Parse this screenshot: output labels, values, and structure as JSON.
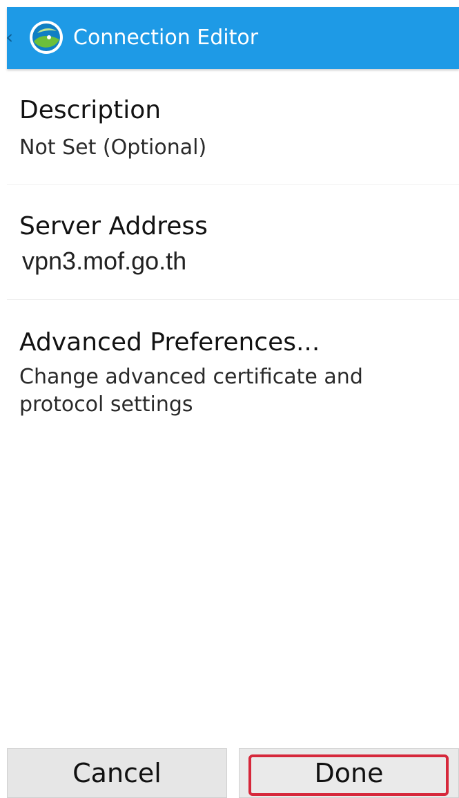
{
  "app": {
    "title": "Connection Editor",
    "icon": "app-logo-icon",
    "accent_color": "#1e9ae6"
  },
  "preferences": [
    {
      "title": "Description",
      "summary": "Not Set (Optional)"
    },
    {
      "title": "Server Address",
      "summary": "vpn3.mof.go.th"
    },
    {
      "title": "Advanced Preferences...",
      "summary": "Change advanced certificate and protocol settings"
    }
  ],
  "buttons": {
    "cancel_label": "Cancel",
    "done_label": "Done",
    "highlight_color": "#d6283b"
  }
}
